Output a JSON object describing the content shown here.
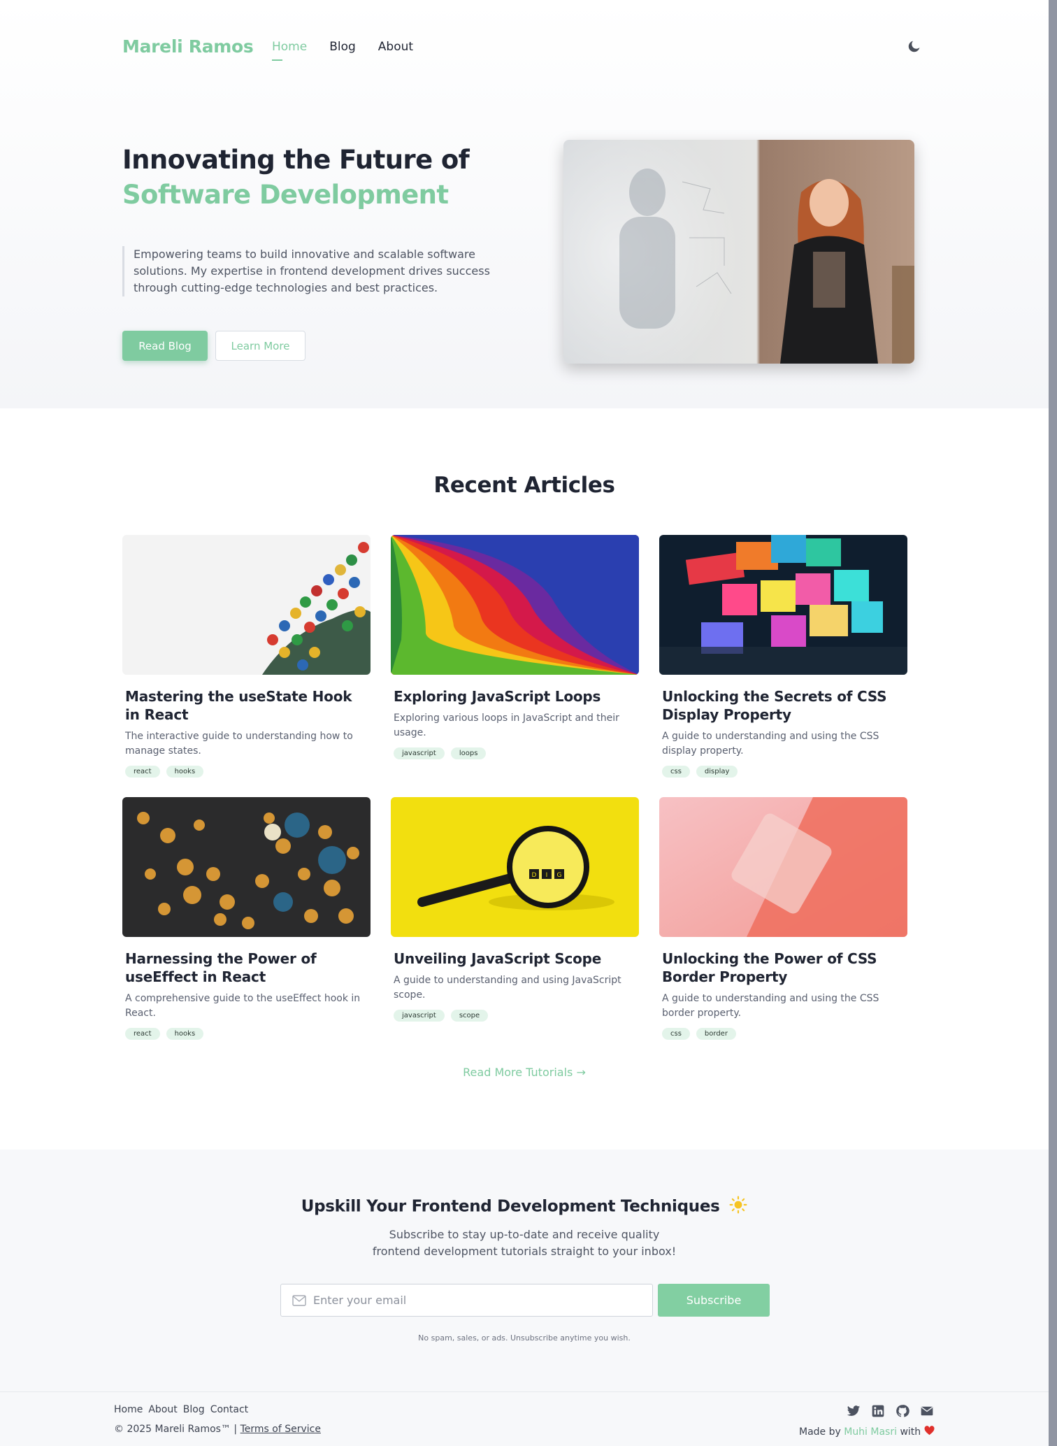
{
  "header": {
    "logo": "Mareli Ramos",
    "nav": [
      "Home",
      "Blog",
      "About"
    ],
    "active_nav": "Home",
    "theme_icon": "moon-icon"
  },
  "hero": {
    "title_line1": "Innovating the Future of",
    "title_line2": "Software Development",
    "description": "Empowering teams to build innovative and scalable software solutions. My expertise in frontend development drives success through cutting-edge technologies and best practices.",
    "primary_button": "Read Blog",
    "secondary_button": "Learn More"
  },
  "articles": {
    "heading": "Recent Articles",
    "items": [
      {
        "title": "Mastering the useState Hook in React",
        "description": "The interactive guide to understanding how to manage states.",
        "tags": [
          "react",
          "hooks"
        ]
      },
      {
        "title": "Exploring JavaScript Loops",
        "description": "Exploring various loops in JavaScript and their usage.",
        "tags": [
          "javascript",
          "loops"
        ]
      },
      {
        "title": "Unlocking the Secrets of CSS Display Property",
        "description": "A guide to understanding and using the CSS display property.",
        "tags": [
          "css",
          "display"
        ]
      },
      {
        "title": "Harnessing the Power of useEffect in React",
        "description": "A comprehensive guide to the useEffect hook in React.",
        "tags": [
          "react",
          "hooks"
        ]
      },
      {
        "title": "Unveiling JavaScript Scope",
        "description": "A guide to understanding and using JavaScript scope.",
        "tags": [
          "javascript",
          "scope"
        ]
      },
      {
        "title": "Unlocking the Power of CSS Border Property",
        "description": "A guide to understanding and using the CSS border property.",
        "tags": [
          "css",
          "border"
        ]
      }
    ],
    "read_more": "Read More Tutorials →"
  },
  "subscribe": {
    "title": "Upskill Your Frontend Development Techniques",
    "text_line1": "Subscribe to stay up-to-date and receive quality",
    "text_line2": "frontend development tutorials straight to your inbox!",
    "email_placeholder": "Enter your email",
    "button": "Subscribe",
    "note": "No spam, sales, or ads. Unsubscribe anytime you wish."
  },
  "footer": {
    "links": [
      "Home",
      "About",
      "Blog",
      "Contact"
    ],
    "copyright": "© 2025 Mareli Ramos™ |",
    "terms": "Terms of Service",
    "made_by_prefix": "Made by",
    "made_by_author": "Muhi Masri",
    "made_by_suffix": "with",
    "social_icons": [
      "twitter-icon",
      "linkedin-icon",
      "github-icon",
      "mail-icon"
    ]
  },
  "colors": {
    "accent": "#7fcba0",
    "text": "#1f2432",
    "muted": "#5a6070",
    "tag_bg": "#e3f4ea"
  }
}
